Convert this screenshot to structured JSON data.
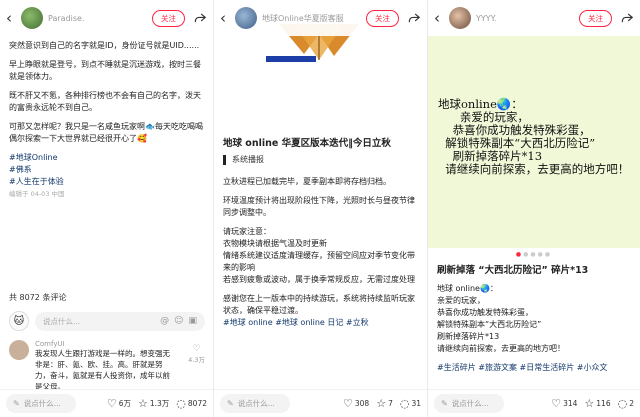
{
  "panels": [
    {
      "username": "Paradise.",
      "follow_label": "关注",
      "lines": [
        "突然意识到自己的名字就是ID，身份证号就是UID......",
        "早上睁眼就是登号，到点不睡就是沉迷游戏，按时三餐就是领体力。",
        "既不肝又不氪，各种排行榜也不会有自己的名字，泼天的富贵永远轮不到自己。",
        "可那又怎样呢？我只是一名咸鱼玩家啊🐟每天吃吃喝喝偶尔探索一下大世界就已经很开心了🥰"
      ],
      "tags": [
        "#地球Online",
        "#佛系",
        "#人生在于体验"
      ],
      "meta": "编辑于 04-03 中国",
      "comment_count": "共 8072 条评论",
      "comment_placeholder": "说点什么...",
      "comment": {
        "user": "ComfyUI",
        "text": "我发现人生跟打游戏是一样的。想变强无非是：肝、氪、欧、挂。高。肝就是努力，奋斗，氪就是有人投资你，成年以前是父母。",
        "likes": "4.3万"
      },
      "bottom": {
        "say": "说点什么...",
        "likes": "6万",
        "stars": "1.3万",
        "comments": "8072"
      }
    },
    {
      "username": "地球Online华夏版客服",
      "follow_label": "关注",
      "title": "地球 online 华夏区版本迭代‖今日立秋",
      "subtitle": "系统播报",
      "lines": [
        "立秋进程已加载完毕，夏季副本即将存档归档。",
        "环境温度预计将出现阶段性下降，光照时长与昼夜节律同步调整中。",
        "请玩家注意：\n衣物模块请根据气温及时更新\n情绪系统建议适度清理缓存，预留空间应对季节变化带来的影响\n若感到疲惫或波动，属于换季常规反应，无需过度处理",
        "感谢您在上一版本中的持续游玩，系统将持续监听玩家状态，确保平稳过渡。"
      ],
      "tags": "#地球 online #地球 online 日记 #立秋",
      "bottom": {
        "say": "说点什么...",
        "likes": "308",
        "stars": "7",
        "comments": "31"
      }
    },
    {
      "username": "YYYY.",
      "follow_label": "关注",
      "image_text": [
        "地球online🌏：",
        "      亲爱的玩家，",
        "    恭喜你成功触发特殊彩蛋，",
        "  解锁特殊副本“大西北历险记”",
        "    刷新掉落碎片*13",
        "  请继续向前探索，去更高的地方吧！"
      ],
      "title": "刷新掉落 “大西北历险记” 碎片*13",
      "lines": [
        "地球 online🌏：",
        "亲爱的玩家，",
        "恭喜你成功触发特殊彩蛋，",
        "解锁特殊副本“大西北历险记”",
        "刷新掉落碎片*13",
        "请继续向前探索，去更高的地方吧！"
      ],
      "tags": "#生活碎片 #旅游文案 #日常生活碎片 #小众文",
      "bottom": {
        "say": "说点什么...",
        "likes": "314",
        "stars": "116",
        "comments": "2"
      }
    }
  ],
  "colors": {
    "accent": "#ff2442",
    "tag": "#13386c",
    "card3_bg": "#f1f8d8"
  },
  "icons": [
    "back-arrow-icon",
    "share-icon",
    "pen-icon",
    "heart-icon",
    "star-icon",
    "comment-icon",
    "at-icon",
    "emoji-icon",
    "image-icon"
  ]
}
